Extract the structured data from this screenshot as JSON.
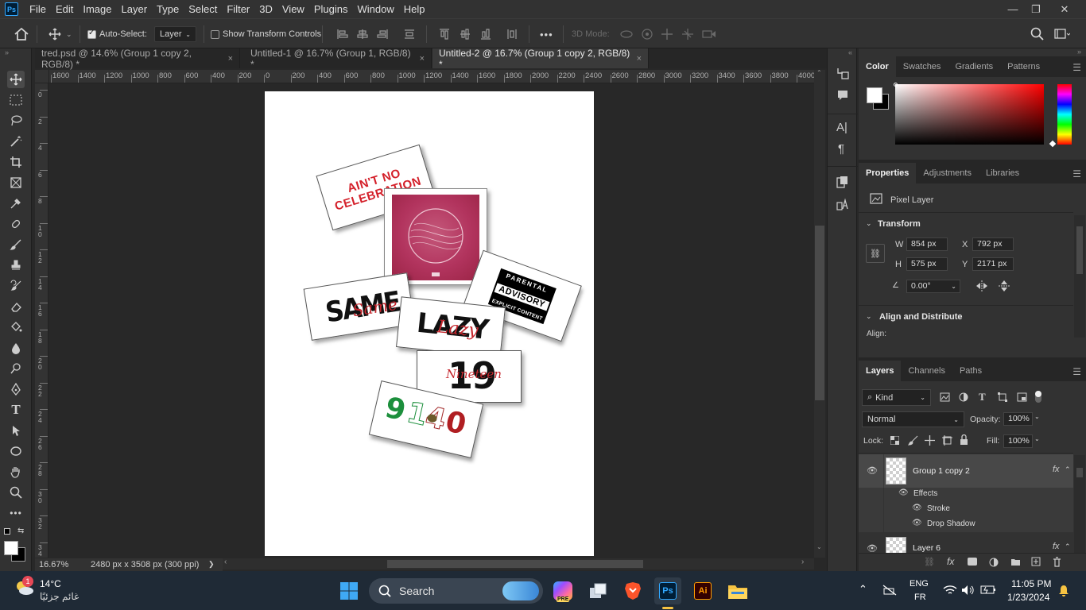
{
  "menubar": {
    "logo": "Ps",
    "items": [
      "File",
      "Edit",
      "Image",
      "Layer",
      "Type",
      "Select",
      "Filter",
      "3D",
      "View",
      "Plugins",
      "Window",
      "Help"
    ],
    "minimize": "—",
    "restore": "❐",
    "close": "✕"
  },
  "options": {
    "auto_select_label": "Auto-Select:",
    "auto_select_checked": true,
    "layer_dropdown": "Layer",
    "transform_label": "Show Transform Controls",
    "more": "•••",
    "mode3d_label": "3D Mode:"
  },
  "tabs": [
    {
      "label": "tred.psd @ 14.6% (Group 1 copy 2, RGB/8) *",
      "close": "×",
      "active": false
    },
    {
      "label": "Untitled-1 @ 16.7% (Group 1, RGB/8) *",
      "close": "×",
      "active": false
    },
    {
      "label": "Untitled-2 @ 16.7% (Group 1 copy 2, RGB/8) *",
      "close": "×",
      "active": true
    }
  ],
  "ruler_h": [
    "1600",
    "1400",
    "1200",
    "1000",
    "800",
    "600",
    "400",
    "200",
    "0",
    "200",
    "400",
    "600",
    "800",
    "1000",
    "1200",
    "1400",
    "1600",
    "1800",
    "2000",
    "2200",
    "2400",
    "2600",
    "2800",
    "3000",
    "3200",
    "3400",
    "3600",
    "3800",
    "4000"
  ],
  "ruler_v": [
    "0",
    "2",
    "4",
    "6",
    "8",
    "1 0",
    "1 2",
    "1 4",
    "1 6",
    "1 8",
    "2 0",
    "2 2",
    "2 4",
    "2 6",
    "2 8",
    "3 0",
    "3 2",
    "3 4"
  ],
  "artwork": {
    "card1_text": "AIN'T NO CELEBRATION",
    "card2_caption": "",
    "card3_line1": "PARENTAL",
    "card3_line2": "ADVISORY",
    "card3_line3": "EXPLICIT CONTENT",
    "card4_text": "SAME",
    "card4_script": "Same",
    "card5_text": "LAZY",
    "card5_script": "Lazy",
    "card6_text": "19",
    "card6_script": "Nineteen",
    "card7_text_a": "9",
    "card7_text_b": "1",
    "card7_text_c": "4",
    "card7_text_d": "0"
  },
  "status": {
    "zoom": "16.67%",
    "doc_info": "2480 px x 3508 px (300 ppi)",
    "arrow": "❯"
  },
  "color_panel": {
    "tabs": [
      "Color",
      "Swatches",
      "Gradients",
      "Patterns"
    ],
    "active": "Color",
    "foreground": "#ffffff",
    "background": "#000000"
  },
  "properties": {
    "tabs": [
      "Properties",
      "Adjustments",
      "Libraries"
    ],
    "layer_type": "Pixel Layer",
    "transform_title": "Transform",
    "w_label": "W",
    "w_value": "854 px",
    "x_label": "X",
    "x_value": "792 px",
    "h_label": "H",
    "h_value": "575 px",
    "y_label": "Y",
    "y_value": "2171 px",
    "angle_value": "0.00°",
    "align_title": "Align and Distribute",
    "align_label": "Align:"
  },
  "layers": {
    "tabs": [
      "Layers",
      "Channels",
      "Paths"
    ],
    "kind_label": "Kind",
    "blend_mode": "Normal",
    "opacity_label": "Opacity:",
    "opacity_value": "100%",
    "lock_label": "Lock:",
    "fill_label": "Fill:",
    "fill_value": "100%",
    "rows": [
      {
        "name": "Group 1 copy 2",
        "fx": "fx"
      },
      {
        "name": "Effects"
      },
      {
        "name": "Stroke"
      },
      {
        "name": "Drop Shadow"
      },
      {
        "name": "Layer 6",
        "fx": "fx"
      }
    ]
  },
  "taskbar": {
    "weather_temp": "14°C",
    "weather_desc": "غائم جزئيًا",
    "weather_badge": "1",
    "search_label": "Search",
    "lang_top": "ENG",
    "lang_bottom": "FR",
    "time": "11:05 PM",
    "date": "1/23/2024",
    "ps_label": "Ps",
    "ai_label": "Ai"
  }
}
